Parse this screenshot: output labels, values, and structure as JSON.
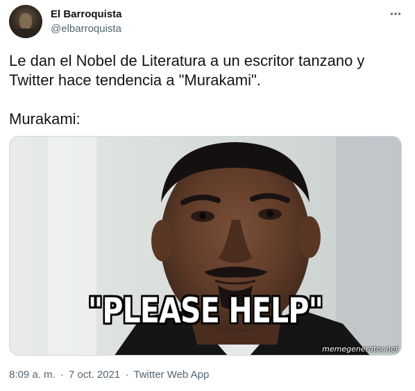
{
  "author": {
    "name": "El Barroquista",
    "handle": "@elbarroquista"
  },
  "more_icon": "more-horizontal-icon",
  "tweet": {
    "lines": [
      "Le dan el Nobel de Literatura a un escritor tanzano y",
      "Twitter hace tendencia a \"Murakami\".",
      "Murakami:"
    ]
  },
  "media": {
    "caption": "\"PLEASE HELP\"",
    "watermark": "memegenerator.net"
  },
  "meta": {
    "time": "8:09 a. m.",
    "separator": "·",
    "date": "7 oct. 2021",
    "source": "Twitter Web App"
  }
}
